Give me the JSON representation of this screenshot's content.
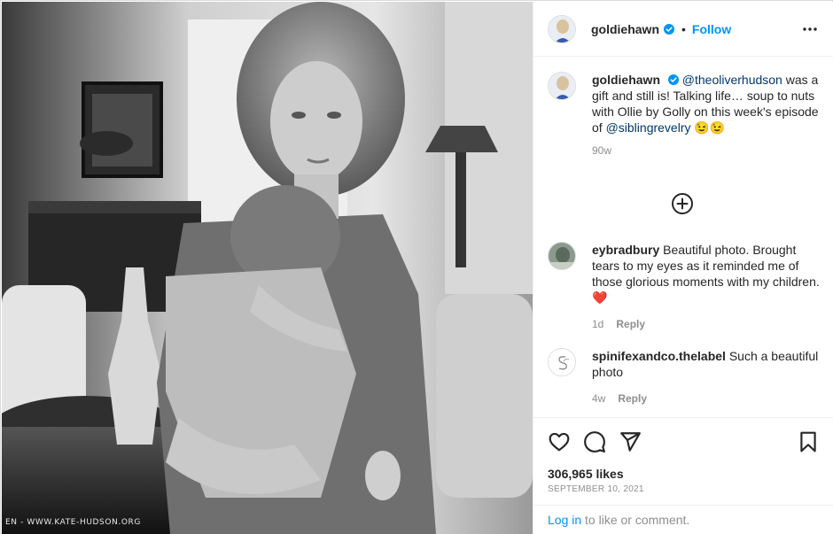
{
  "photo": {
    "watermark": "EN - WWW.KATE-HUDSON.ORG"
  },
  "header": {
    "username": "goldiehawn",
    "separator": "•",
    "follow_label": "Follow",
    "more_icon": "more-options-icon"
  },
  "caption": {
    "username": "goldiehawn",
    "mention": "@theoliverhudson",
    "text": " was a gift and still is! Talking life… soup to nuts with Ollie by Golly on this week's episode of ",
    "mention2": "@siblingrevelry",
    "emoji": " 😉😉",
    "time": "90w"
  },
  "comments": [
    {
      "username": "eybradbury",
      "text": " Beautiful photo. Brought tears to my eyes as it reminded me of those glorious moments with my children. ❤️",
      "time": "1d",
      "reply": "Reply"
    },
    {
      "username": "spinifexandco.thelabel",
      "text": " Such a beautiful photo",
      "time": "4w",
      "reply": "Reply"
    }
  ],
  "actions": {
    "likes": "306,965 likes",
    "date": "SEPTEMBER 10, 2021"
  },
  "login": {
    "link": "Log in",
    "rest": " to like or comment."
  },
  "colors": {
    "accent": "#0095f6",
    "mention": "#00376b",
    "muted": "#8e8e8e",
    "heart": "#ed4956"
  }
}
